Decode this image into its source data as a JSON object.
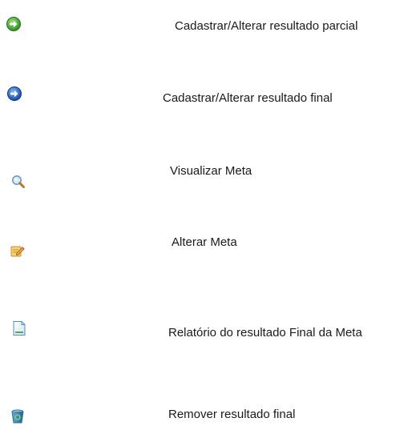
{
  "legend": {
    "items": [
      {
        "icon": "green-arrow-right-icon",
        "label": "Cadastrar/Alterar resultado parcial",
        "icon_color": "#3aa52a"
      },
      {
        "icon": "blue-arrow-right-icon",
        "label": "Cadastrar/Alterar resultado final",
        "icon_color": "#1f6fd6"
      },
      {
        "icon": "magnifier-icon",
        "label": "Visualizar Meta",
        "icon_color": "#5b9bd5"
      },
      {
        "icon": "edit-note-icon",
        "label": "Alterar Meta",
        "icon_color": "#e8a93a"
      },
      {
        "icon": "document-icon",
        "label": "Relatório do resultado Final da Meta",
        "icon_color": "#5aa0d8"
      },
      {
        "icon": "recycle-bin-icon",
        "label": "Remover resultado final",
        "icon_color": "#2f7fb8"
      }
    ]
  }
}
